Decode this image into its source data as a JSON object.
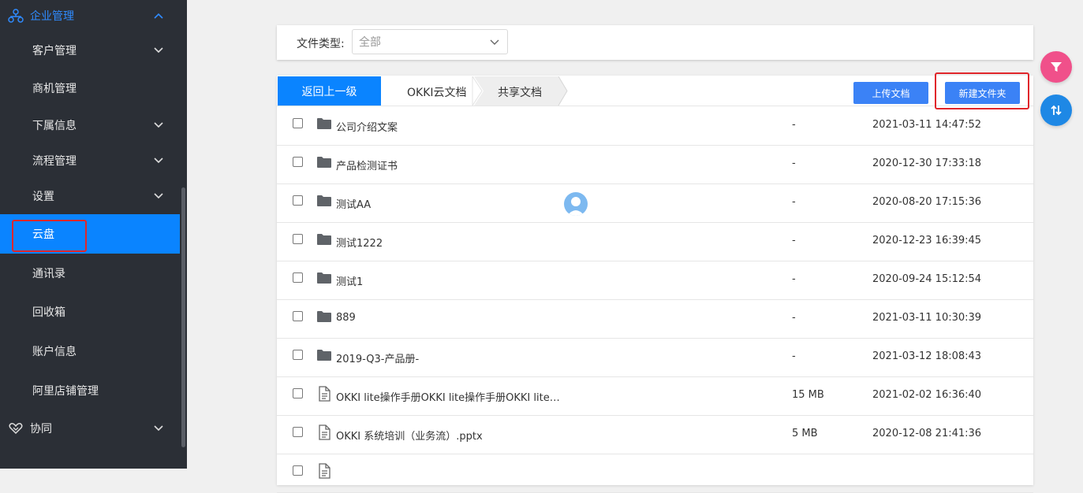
{
  "sidebar": {
    "group_title": "企业管理",
    "items": [
      {
        "label": "客户管理"
      },
      {
        "label": "商机管理"
      },
      {
        "label": "下属信息"
      },
      {
        "label": "流程管理"
      },
      {
        "label": "设置"
      },
      {
        "label": "云盘"
      },
      {
        "label": "通讯录"
      },
      {
        "label": "回收箱"
      },
      {
        "label": "账户信息"
      },
      {
        "label": "阿里店铺管理"
      }
    ],
    "bottom_group": "协同",
    "active_item": "云盘"
  },
  "filter": {
    "label": "文件类型:",
    "selected": "全部"
  },
  "toolbar": {
    "back_label": "返回上一级",
    "breadcrumb": [
      "OKKI云文档",
      "共享文档"
    ],
    "upload_label": "上传文档",
    "new_folder_label": "新建文件夹"
  },
  "files": [
    {
      "name": "公司介绍文案",
      "type": "folder",
      "size": "-",
      "time": "2021-03-11 14:47:52"
    },
    {
      "name": "产品检测证书",
      "type": "folder",
      "size": "-",
      "time": "2020-12-30 17:33:18"
    },
    {
      "name": "测试AA",
      "type": "folder",
      "size": "-",
      "time": "2020-08-20 17:15:36"
    },
    {
      "name": "测试1222",
      "type": "folder",
      "size": "-",
      "time": "2020-12-23 16:39:45"
    },
    {
      "name": "测试1",
      "type": "folder",
      "size": "-",
      "time": "2020-09-24 15:12:54"
    },
    {
      "name": "889",
      "type": "folder",
      "size": "-",
      "time": "2021-03-11 10:30:39"
    },
    {
      "name": "2019-Q3-产品册-",
      "type": "folder",
      "size": "-",
      "time": "2021-03-12 18:08:43"
    },
    {
      "name": "OKKI lite操作手册OKKI lite操作手册OKKI lite…",
      "type": "document",
      "size": "15 MB",
      "time": "2021-02-02 16:36:40"
    },
    {
      "name": "OKKI 系统培训（业务流）.pptx",
      "type": "document",
      "size": "5 MB",
      "time": "2020-12-08 21:41:36"
    }
  ],
  "colors": {
    "sidebar_bg": "#2b2f36",
    "accent": "#0a84ff",
    "button": "#3b82f6",
    "highlight_box": "#e0262b",
    "filter_fab": "#f0508a",
    "sort_fab": "#1e88e5"
  },
  "icons": {
    "group": "org-chart-icon",
    "bottom_group": "handshake-icon",
    "folder": "folder-icon",
    "document": "document-icon",
    "filter_fab": "filter-icon",
    "sort_fab": "sort-icon"
  }
}
